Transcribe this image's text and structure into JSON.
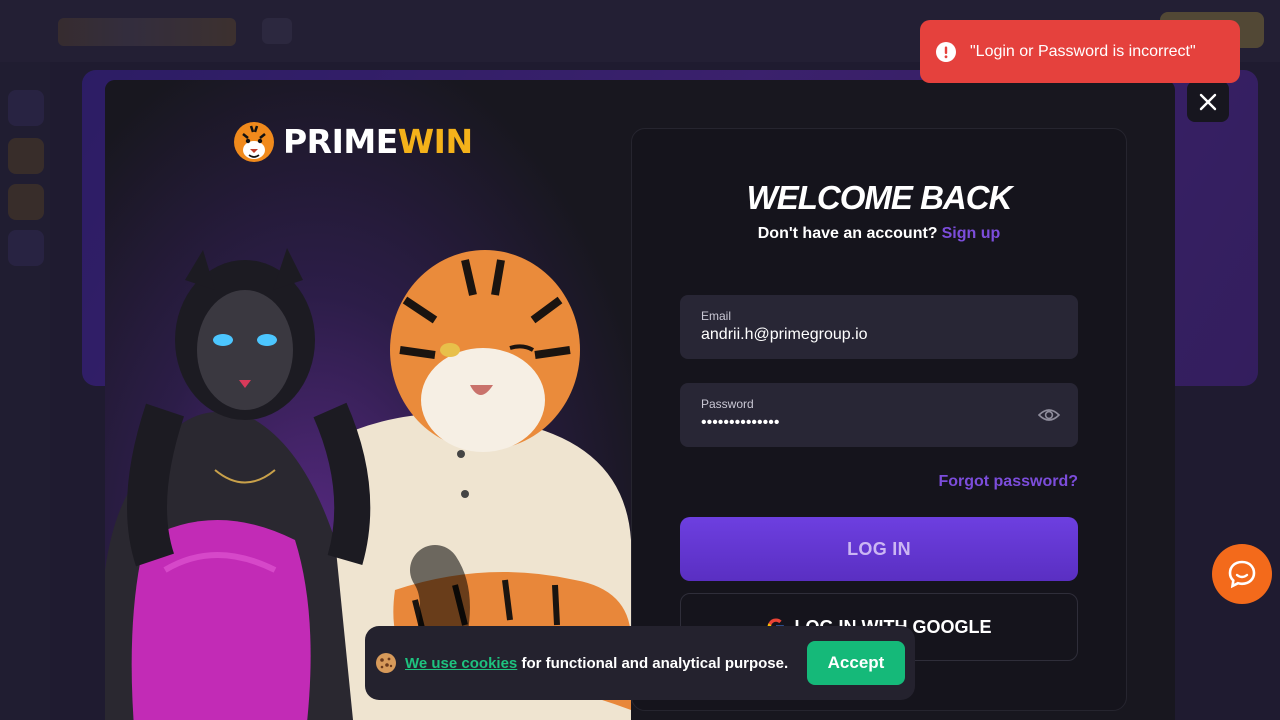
{
  "toast": {
    "message": "\"Login or Password is incorrect\"",
    "color": "#e5413d"
  },
  "brand": {
    "part1": "PRIME",
    "part2": "WIN",
    "accent": "#f4b21a"
  },
  "auth": {
    "title": "WELCOME BACK",
    "no_account": "Don't have an account?",
    "signup_link": "Sign up",
    "email_label": "Email",
    "email_value": "andrii.h@primegroup.io",
    "password_label": "Password",
    "password_value": "••••••••••••••",
    "forgot_link": "Forgot password?",
    "login_button": "LOG IN",
    "google_button": "LOG IN WITH GOOGLE"
  },
  "cookie": {
    "link_text": "We use cookies",
    "text": "for functional and analytical purpose.",
    "accept_button": "Accept"
  },
  "colors": {
    "primary": "#6d3fe0",
    "accept": "#15b979",
    "chat": "#f36a1b"
  }
}
